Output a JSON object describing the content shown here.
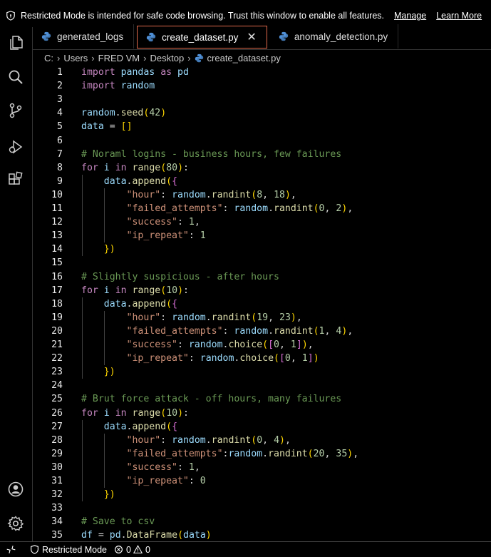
{
  "banner": {
    "message": "Restricted Mode is intended for safe code browsing. Trust this window to enable all features.",
    "manage": "Manage",
    "learn_more": "Learn More"
  },
  "activity_bar": [
    "explorer-icon",
    "search-icon",
    "source-control-icon",
    "run-debug-icon",
    "extensions-icon",
    "account-icon",
    "settings-gear-icon"
  ],
  "tabs": [
    {
      "label": "generated_logs",
      "active": false
    },
    {
      "label": "create_dataset.py",
      "active": true
    },
    {
      "label": "anomaly_detection.py",
      "active": false
    }
  ],
  "breadcrumb": [
    "C:",
    "Users",
    "FRED VM",
    "Desktop",
    "create_dataset.py"
  ],
  "code_lines": [
    {
      "n": "1",
      "t": "import pandas as pd"
    },
    {
      "n": "2",
      "t": "import random"
    },
    {
      "n": "3",
      "t": ""
    },
    {
      "n": "4",
      "t": "random.seed(42)"
    },
    {
      "n": "5",
      "t": "data = []"
    },
    {
      "n": "6",
      "t": ""
    },
    {
      "n": "7",
      "t": "# Noraml logins - business hours, few failures"
    },
    {
      "n": "8",
      "t": "for i in range(80):"
    },
    {
      "n": "9",
      "t": "    data.append({"
    },
    {
      "n": "10",
      "t": "        \"hour\": random.randint(8, 18),"
    },
    {
      "n": "11",
      "t": "        \"failed_attempts\": random.randint(0, 2),"
    },
    {
      "n": "12",
      "t": "        \"success\": 1,"
    },
    {
      "n": "13",
      "t": "        \"ip_repeat\": 1"
    },
    {
      "n": "14",
      "t": "    })"
    },
    {
      "n": "15",
      "t": ""
    },
    {
      "n": "16",
      "t": "# Slightly suspicious - after hours"
    },
    {
      "n": "17",
      "t": "for i in range(10):"
    },
    {
      "n": "18",
      "t": "    data.append({"
    },
    {
      "n": "19",
      "t": "        \"hour\": random.randint(19, 23),"
    },
    {
      "n": "20",
      "t": "        \"failed_attempts\": random.randint(1, 4),"
    },
    {
      "n": "21",
      "t": "        \"success\": random.choice([0, 1]),"
    },
    {
      "n": "22",
      "t": "        \"ip_repeat\": random.choice([0, 1])"
    },
    {
      "n": "23",
      "t": "    })"
    },
    {
      "n": "24",
      "t": ""
    },
    {
      "n": "25",
      "t": "# Brut force attack - off hours, many failures"
    },
    {
      "n": "26",
      "t": "for i in range(10):"
    },
    {
      "n": "27",
      "t": "    data.append({"
    },
    {
      "n": "28",
      "t": "        \"hour\": random.randint(0, 4),"
    },
    {
      "n": "29",
      "t": "        \"failed_attempts\":random.randint(20, 35),"
    },
    {
      "n": "30",
      "t": "        \"success\": 1,"
    },
    {
      "n": "31",
      "t": "        \"ip_repeat\": 0"
    },
    {
      "n": "32",
      "t": "    })"
    },
    {
      "n": "33",
      "t": ""
    },
    {
      "n": "34",
      "t": "# Save to csv"
    },
    {
      "n": "35",
      "t": "df = pd.DataFrame(data)"
    }
  ],
  "status": {
    "mode": "Restricted Mode",
    "errors": "0",
    "warnings": "0"
  },
  "colors": {
    "background": "#000000",
    "active_tab_border": "#e0694b",
    "keyword": "#c586c0",
    "string": "#ce9178",
    "number": "#b5cea8",
    "comment": "#6a9955",
    "function": "#dcdcaa"
  }
}
